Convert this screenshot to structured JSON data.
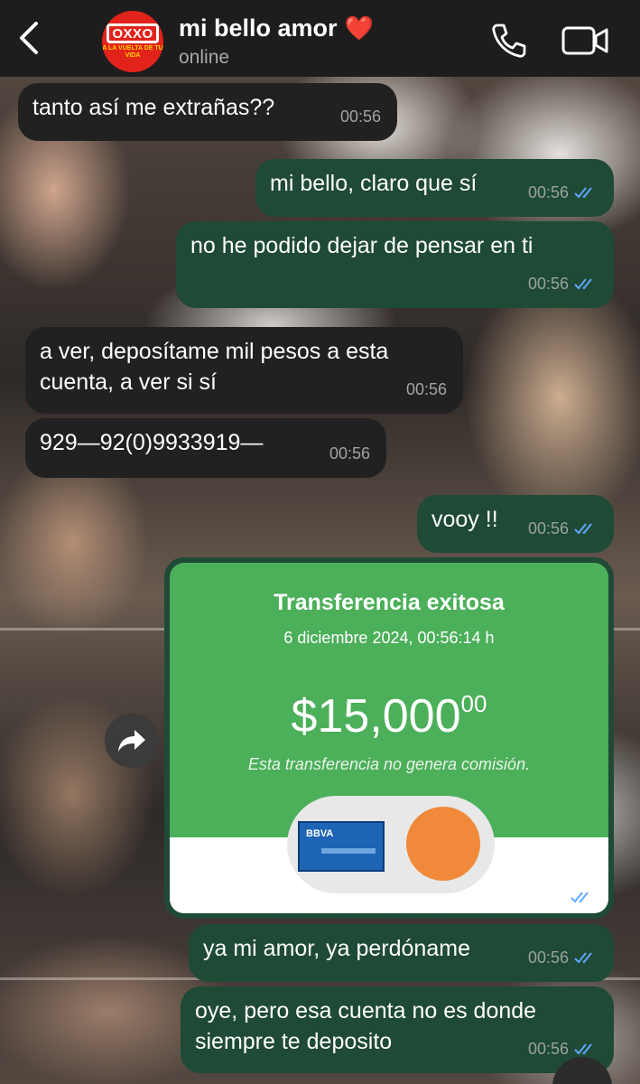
{
  "header": {
    "contact_name": "mi bello amor",
    "contact_emoji": "❤️",
    "status": "online",
    "avatar": {
      "brand": "OXXO",
      "tagline": "A LA VUELTA DE TU VIDA"
    }
  },
  "messages": [
    {
      "dir": "in",
      "text": "tanto así me extrañas??",
      "time": "00:56"
    },
    {
      "dir": "out",
      "text": "mi bello, claro que sí",
      "time": "00:56"
    },
    {
      "dir": "out",
      "text": "no he podido dejar de pensar en ti",
      "time": "00:56"
    },
    {
      "dir": "in",
      "text": "a ver, deposítame mil pesos a esta cuenta, a ver si sí",
      "time": "00:56"
    },
    {
      "dir": "in",
      "text": "929—92(0)9933919—",
      "time": "00:56"
    },
    {
      "dir": "out",
      "text": "vooy !!",
      "time": "00:56"
    },
    {
      "dir": "out",
      "text": "ya mi amor, ya perdóname",
      "time": "00:56"
    },
    {
      "dir": "out",
      "text": "oye, pero esa cuenta no es donde siempre te deposito",
      "time": "00:56"
    }
  ],
  "transfer": {
    "title": "Transferencia exitosa",
    "date": "6 diciembre 2024, 00:56:14 h",
    "amount_main": "$15,000",
    "amount_cents": "00",
    "note": "Esta transferencia no genera comisión.",
    "bank_label": "BBVA",
    "time": "00:56"
  },
  "colors": {
    "header_bg": "#1d1d1d",
    "incoming_bubble": "#212121",
    "outgoing_bubble": "#1f4a36",
    "receipt_green": "#4caf5a",
    "read_ticks": "#5fa8ff"
  },
  "icons": [
    "back-icon",
    "phone-icon",
    "video-icon",
    "forward-icon",
    "double-check-icon"
  ]
}
